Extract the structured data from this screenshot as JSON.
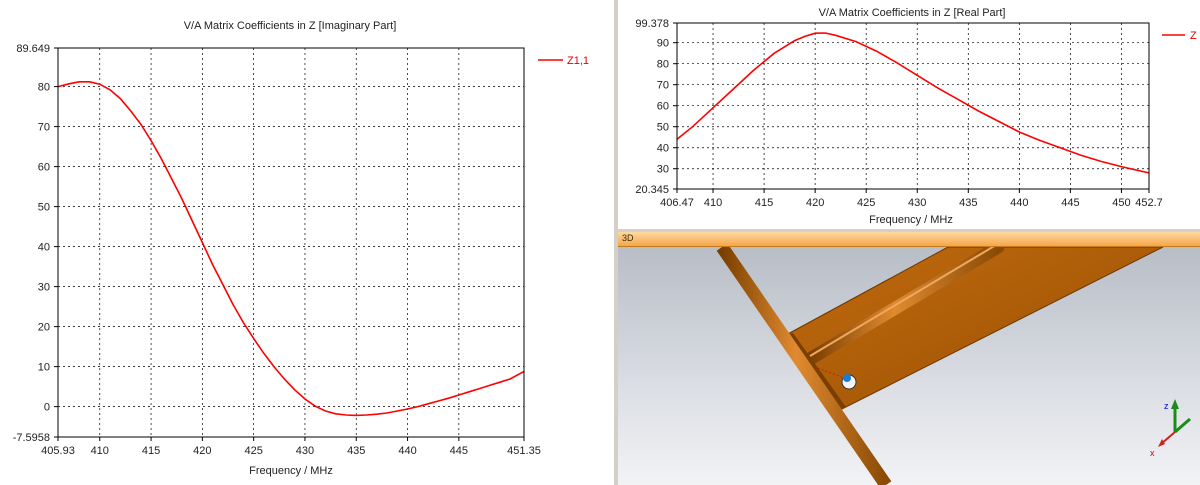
{
  "imag_panel": {
    "title": "V/A Matrix Coefficients in Z [Imaginary Part]",
    "x_label": "Frequency / MHz",
    "legend": "Z1,1",
    "y_ticks": [
      "89.649",
      "80",
      "70",
      "60",
      "50",
      "40",
      "30",
      "20",
      "10",
      "0",
      "-7.5958"
    ],
    "x_ticks": [
      "405.93",
      "410",
      "415",
      "420",
      "425",
      "430",
      "435",
      "440",
      "445",
      "451.35"
    ]
  },
  "real_panel": {
    "title": "V/A Matrix Coefficients in Z [Real Part]",
    "x_label": "Frequency / MHz",
    "legend": "Z",
    "y_ticks": [
      "99.378",
      "90",
      "80",
      "70",
      "60",
      "50",
      "40",
      "30",
      "20.345"
    ],
    "x_ticks": [
      "406.47",
      "410",
      "415",
      "420",
      "425",
      "430",
      "435",
      "440",
      "445",
      "450",
      "452.7"
    ]
  },
  "view3d": {
    "label": "3D",
    "axis_z": "z",
    "axis_x": "x"
  },
  "colors": {
    "curve": "#ff0000",
    "grid": "#000000",
    "copper": "#b35f00",
    "header": "#f5a64a"
  },
  "chart_data": [
    {
      "type": "line",
      "title": "V/A Matrix Coefficients in Z [Imaginary Part]",
      "xlabel": "Frequency / MHz",
      "ylabel": "",
      "xlim": [
        405.93,
        451.35
      ],
      "ylim": [
        -7.5958,
        89.649
      ],
      "grid": true,
      "legend": "top-right",
      "series": [
        {
          "name": "Z1,1",
          "x": [
            405.93,
            407,
            408,
            409,
            410,
            411,
            412,
            413,
            414,
            415,
            416,
            417,
            418,
            419,
            420,
            421,
            422,
            423,
            424,
            425,
            426,
            427,
            428,
            429,
            430,
            431,
            432,
            433,
            434,
            435,
            436,
            437,
            438,
            439,
            440,
            441,
            442,
            443,
            444,
            445,
            446,
            447,
            448,
            449,
            450,
            451.35
          ],
          "y": [
            80,
            80.7,
            81.2,
            81.2,
            80.6,
            79.2,
            77.0,
            74.0,
            70.6,
            66.5,
            62.0,
            57.0,
            52.0,
            46.5,
            41.0,
            35.5,
            30.5,
            25.5,
            21.0,
            17.0,
            13.3,
            9.9,
            6.9,
            4.2,
            1.9,
            0.1,
            -1.1,
            -1.8,
            -2.1,
            -2.2,
            -2.1,
            -1.9,
            -1.6,
            -1.1,
            -0.6,
            0.0,
            0.7,
            1.4,
            2.1,
            2.9,
            3.7,
            4.5,
            5.3,
            6.1,
            6.9,
            8.8
          ]
        }
      ]
    },
    {
      "type": "line",
      "title": "V/A Matrix Coefficients in Z [Real Part]",
      "xlabel": "Frequency / MHz",
      "ylabel": "",
      "xlim": [
        406.47,
        452.7
      ],
      "ylim": [
        20.345,
        99.378
      ],
      "grid": true,
      "legend": "top-right",
      "series": [
        {
          "name": "Z",
          "x": [
            406.47,
            408,
            410,
            412,
            414,
            416,
            418,
            419,
            420,
            421,
            422,
            424,
            426,
            428,
            430,
            432,
            434,
            436,
            438,
            440,
            442,
            444,
            446,
            448,
            450,
            452.7
          ],
          "y": [
            44,
            50,
            59,
            68,
            77,
            85,
            91,
            93,
            94.5,
            94.6,
            93.5,
            90.5,
            86,
            80.5,
            74.5,
            68.5,
            63,
            57.5,
            52.5,
            47.5,
            43.5,
            40,
            36.5,
            33.5,
            31,
            28
          ]
        }
      ]
    }
  ]
}
